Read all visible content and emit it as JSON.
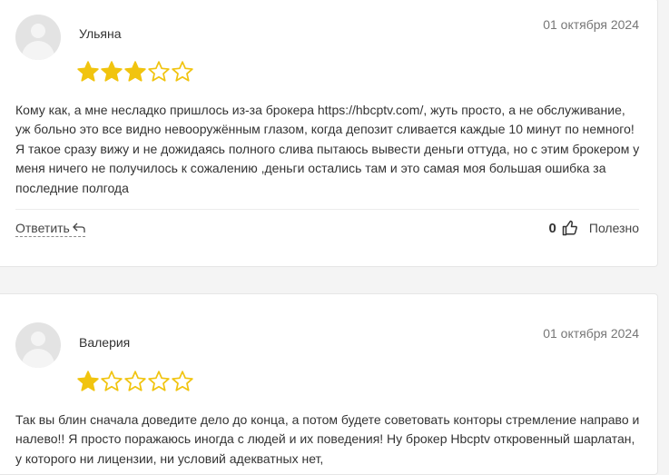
{
  "reviews": [
    {
      "author": "Ульяна",
      "date": "01 октября 2024",
      "rating": 3,
      "max_rating": 5,
      "text": "Кому как, а мне несладко пришлось из-за брокера https://hbcptv.com/, жуть просто, а не обслуживание, уж больно это все видно невооружённым глазом, когда депозит сливается каждые 10 минут по немного! Я такое сразу вижу и не дожидаясь полного слива пытаюсь вывести деньги оттуда, но с этим брокером у меня ничего не получилось к сожалению ,деньги остались там и это самая моя большая ошибка за последние полгода",
      "reply_label": "Ответить",
      "useful_count": "0",
      "useful_label": "Полезно"
    },
    {
      "author": "Валерия",
      "date": "01 октября 2024",
      "rating": 1,
      "max_rating": 5,
      "text": "Так вы блин сначала доведите дело до конца, а потом будете советовать конторы стремление направо и налево!! Я просто поражаюсь иногда с людей и их поведения! Ну брокер Hbcptv откровенный шарлатан, у которого ни лицензии, ни условий адекватных нет,"
    }
  ],
  "icons": {
    "avatar": "user-placeholder-icon",
    "star_filled": "star-filled-icon",
    "star_empty": "star-outline-icon",
    "reply": "reply-arrow-icon",
    "like": "thumbs-up-icon"
  },
  "colors": {
    "star": "#f1c40f",
    "background": "#f4f4f4",
    "card": "#ffffff"
  }
}
